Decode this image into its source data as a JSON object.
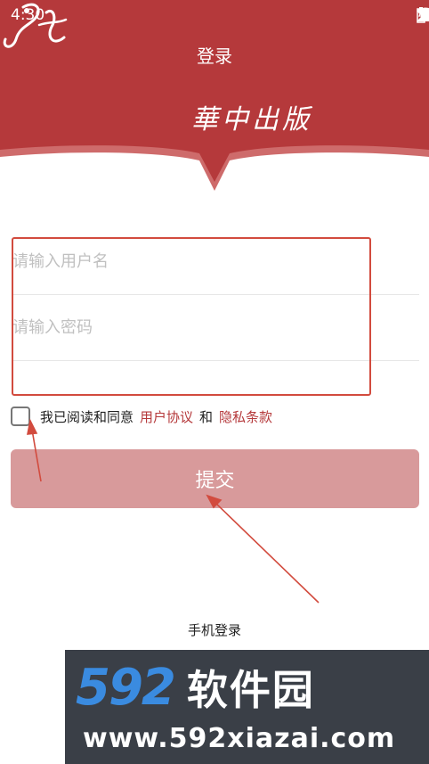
{
  "status_bar": {
    "time": "4:30"
  },
  "header": {
    "title": "登录",
    "brand_name": "華中出版"
  },
  "form": {
    "username_placeholder": "请输入用户名",
    "password_placeholder": "请输入密码"
  },
  "agreement": {
    "prefix": "我已阅读和同意",
    "user_agreement": "用户协议",
    "conjunction": "和",
    "privacy_terms": "隐私条款"
  },
  "submit_label": "提交",
  "phone_login_label": "手机登录",
  "watermark": {
    "brand_number": "592",
    "brand_chinese": "软件园",
    "url": "www.592xiazai.com"
  },
  "colors": {
    "header": "#b5393b",
    "submit": "#d89a9b",
    "link": "#b5393b",
    "annotation": "#d24b3e"
  }
}
